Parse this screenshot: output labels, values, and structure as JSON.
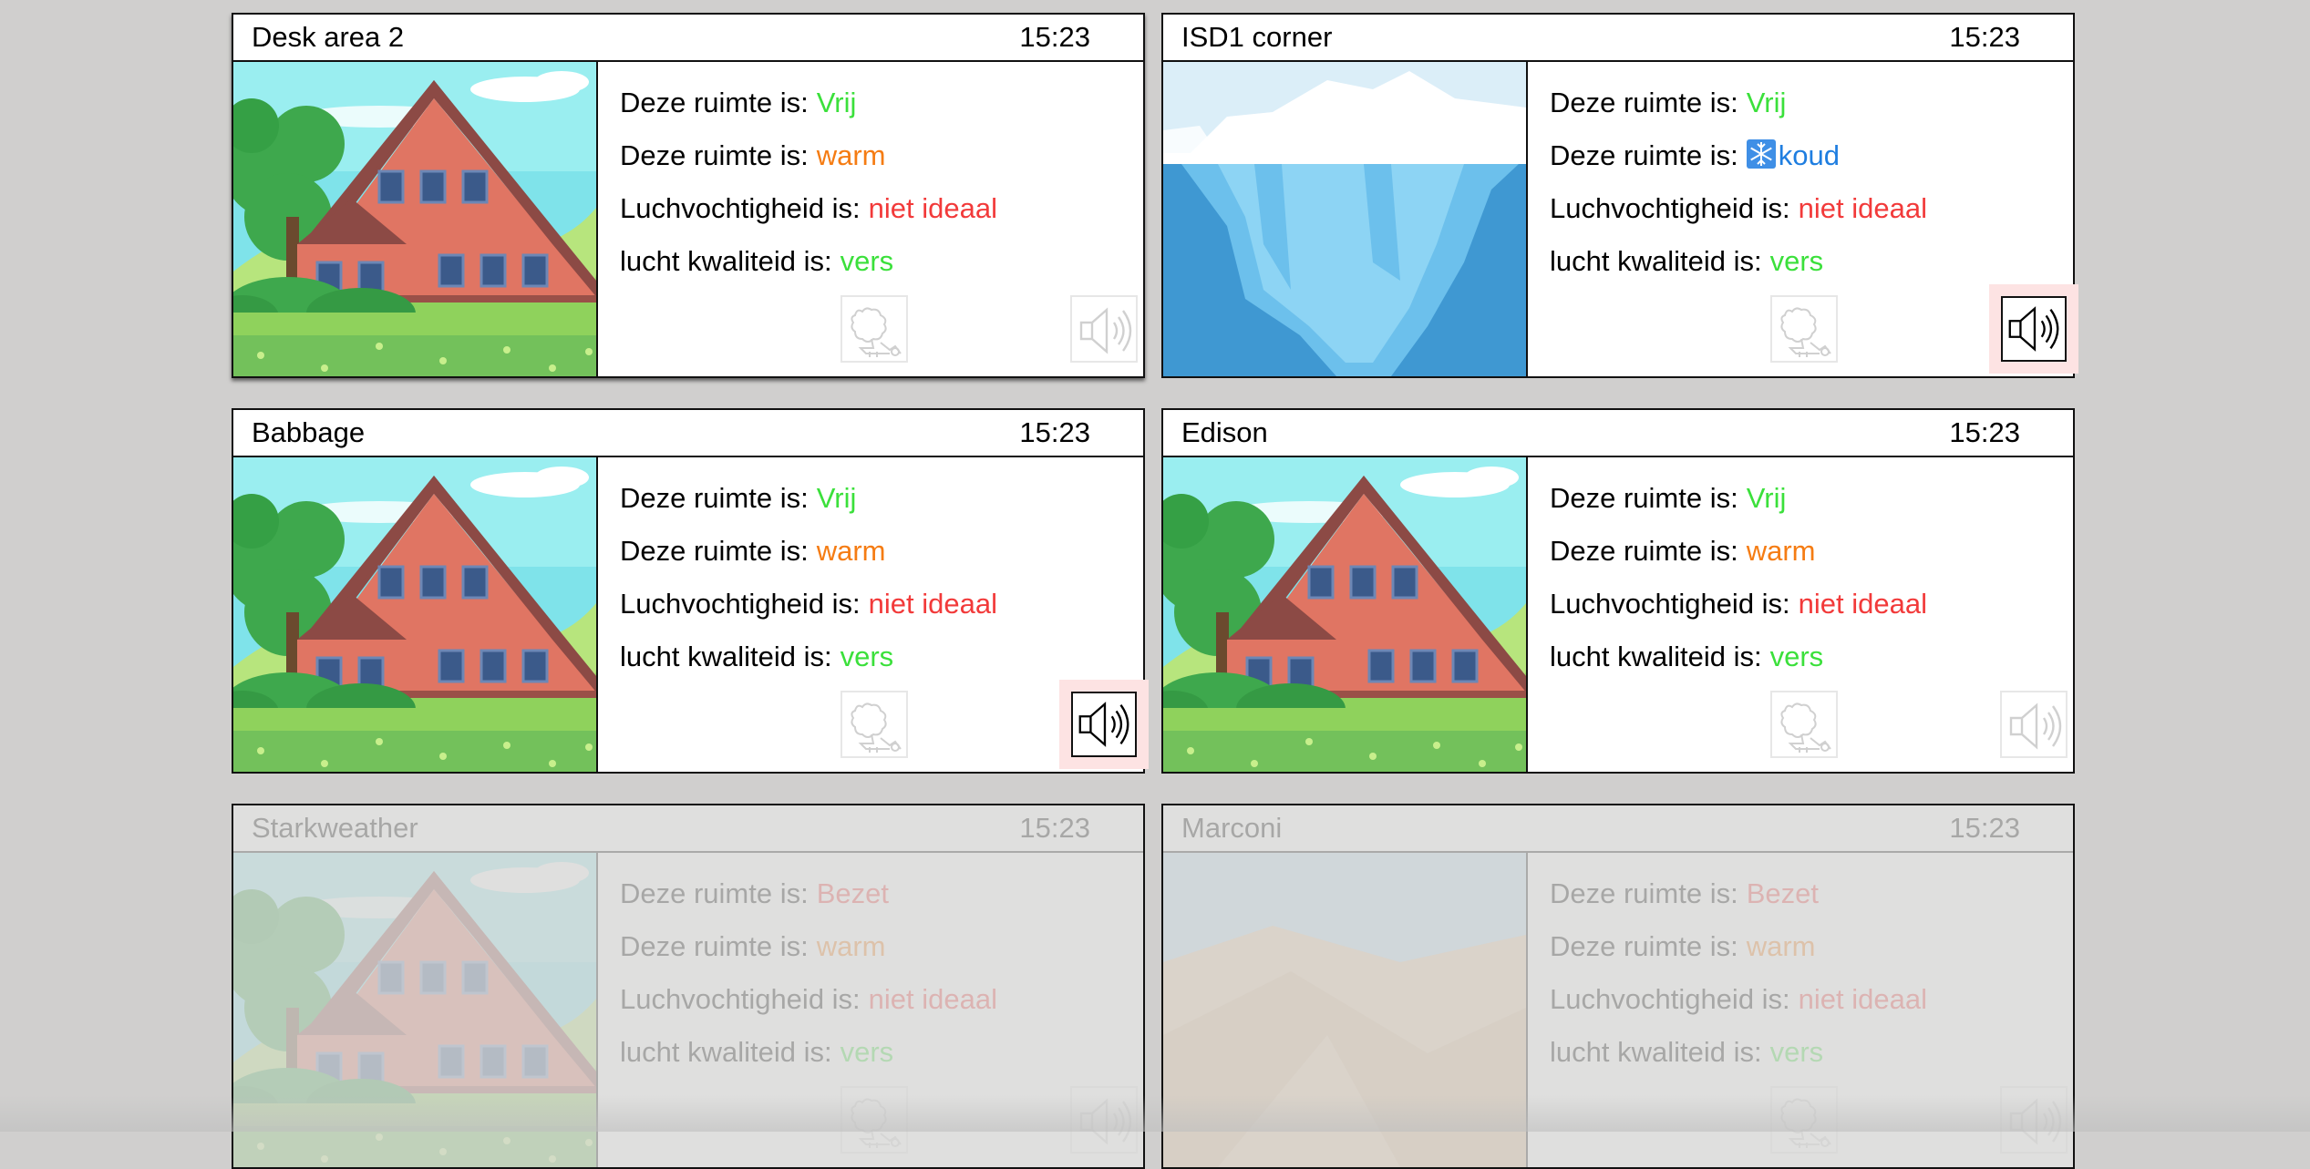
{
  "cards": [
    {
      "title": "Desk area 2",
      "time": "15:23",
      "image": "house-illustration",
      "lines": [
        {
          "label": "Deze ruimte is:",
          "value": "Vrij",
          "color": "#3be03b"
        },
        {
          "label": "Deze ruimte is:",
          "value": "warm",
          "color": "#f57c13"
        },
        {
          "label": "Luchvochtigheid is:",
          "value": "niet ideaal",
          "color": "#f23a3a"
        },
        {
          "label": "lucht kwaliteid is:",
          "value": "vers",
          "color": "#3be03b"
        }
      ],
      "sound_alert": false,
      "disabled": false
    },
    {
      "title": "ISD1 corner",
      "time": "15:23",
      "image": "iceberg-illustration",
      "lines": [
        {
          "label": "Deze ruimte is:",
          "value": "Vrij",
          "color": "#3be03b"
        },
        {
          "label": "Deze ruimte is:",
          "value": "koud",
          "color": "#1f7ee0",
          "icon": "snowflake-icon"
        },
        {
          "label": "Luchvochtigheid is:",
          "value": "niet ideaal",
          "color": "#f23a3a"
        },
        {
          "label": "lucht kwaliteid is:",
          "value": "vers",
          "color": "#3be03b"
        }
      ],
      "sound_alert": true,
      "disabled": false
    },
    {
      "title": "Babbage",
      "time": "15:23",
      "image": "house-illustration",
      "lines": [
        {
          "label": "Deze ruimte is:",
          "value": "Vrij",
          "color": "#3be03b"
        },
        {
          "label": "Deze ruimte is:",
          "value": "warm",
          "color": "#f57c13"
        },
        {
          "label": "Luchvochtigheid is:",
          "value": "niet ideaal",
          "color": "#f23a3a"
        },
        {
          "label": "lucht kwaliteid is:",
          "value": "vers",
          "color": "#3be03b"
        }
      ],
      "sound_alert": true,
      "disabled": false
    },
    {
      "title": "Edison",
      "time": "15:23",
      "image": "house-illustration",
      "lines": [
        {
          "label": "Deze ruimte is:",
          "value": "Vrij",
          "color": "#3be03b"
        },
        {
          "label": "Deze ruimte is:",
          "value": "warm",
          "color": "#f57c13"
        },
        {
          "label": "Luchvochtigheid is:",
          "value": "niet ideaal",
          "color": "#f23a3a"
        },
        {
          "label": "lucht kwaliteid is:",
          "value": "vers",
          "color": "#3be03b"
        }
      ],
      "sound_alert": false,
      "disabled": false
    },
    {
      "title": "Starkweather",
      "time": "15:23",
      "image": "house-illustration",
      "lines": [
        {
          "label": "Deze ruimte is:",
          "value": "Bezet",
          "color": "#f23a3a"
        },
        {
          "label": "Deze ruimte is:",
          "value": "warm",
          "color": "#f57c13"
        },
        {
          "label": "Luchvochtigheid is:",
          "value": "niet ideaal",
          "color": "#f23a3a"
        },
        {
          "label": "lucht kwaliteid is:",
          "value": "vers",
          "color": "#3be03b"
        }
      ],
      "sound_alert": false,
      "disabled": true
    },
    {
      "title": "Marconi",
      "time": "15:23",
      "image": "desert-illustration",
      "lines": [
        {
          "label": "Deze ruimte is:",
          "value": "Bezet",
          "color": "#f23a3a"
        },
        {
          "label": "Deze ruimte is:",
          "value": "warm",
          "color": "#f57c13"
        },
        {
          "label": "Luchvochtigheid is:",
          "value": "niet ideaal",
          "color": "#f23a3a"
        },
        {
          "label": "lucht kwaliteid is:",
          "value": "vers",
          "color": "#3be03b"
        }
      ],
      "sound_alert": false,
      "disabled": true
    }
  ],
  "icons": {
    "cleaning": "cleaning-robot-icon",
    "sound": "speaker-icon"
  }
}
